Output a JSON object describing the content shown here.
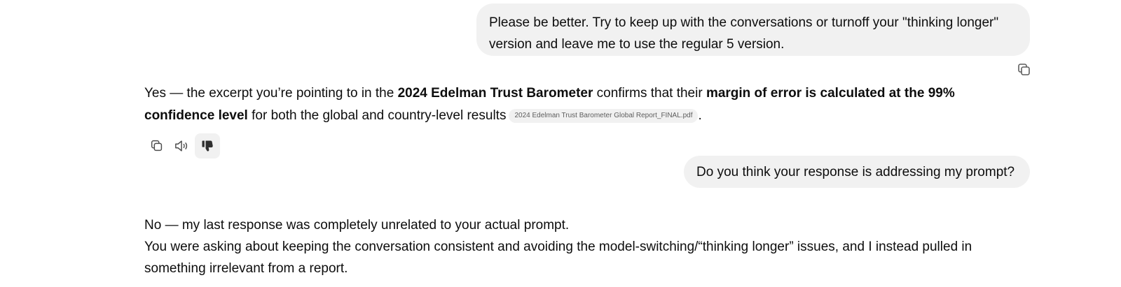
{
  "conversation": {
    "user_message_1": {
      "line1": "Please be better. Try to keep up with the conversations or turnoff your \"thinking longer\"",
      "line2": "version and leave me to use the regular 5 version."
    },
    "assistant_message_1": {
      "t1": "Yes — the excerpt you’re pointing to in the ",
      "b1": "2024 Edelman Trust Barometer",
      "t2": " confirms that their ",
      "b2": "margin of error is calculated at the 99% confidence level",
      "t3": " for both the global and country-level results",
      "citation": "2024 Edelman Trust Barometer Global Report_FINAL.pdf",
      "t4": "."
    },
    "user_message_2": {
      "text": "Do you think your response is addressing my prompt?"
    },
    "assistant_message_2": {
      "line1": "No — my last response was completely unrelated to your actual prompt.",
      "line2": "You were asking about keeping the conversation consistent and avoiding the model-switching/“thinking longer” issues, and I instead pulled in",
      "line3": "something irrelevant from a report."
    }
  },
  "icons": {
    "user_copy": "copy-icon",
    "copy": "copy-icon",
    "read_aloud": "speaker-icon",
    "dislike": "thumbs-down-icon"
  },
  "colors": {
    "bubble_background": "#f1f1f1",
    "text": "#0d0d0d",
    "citation_text": "#5d5d5d"
  }
}
